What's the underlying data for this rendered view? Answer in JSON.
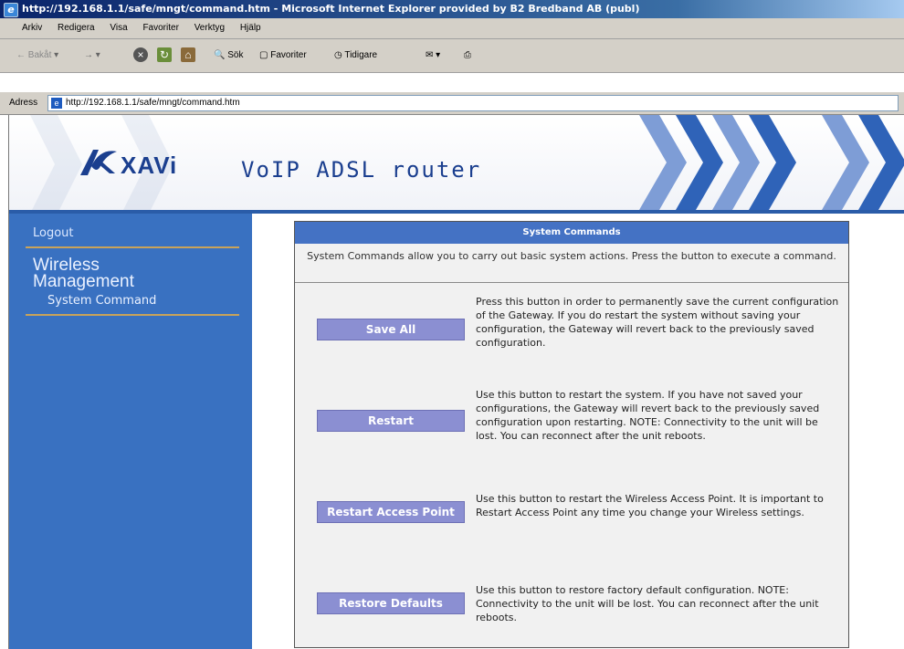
{
  "window": {
    "title": "http://192.168.1.1/safe/mngt/command.htm - Microsoft Internet Explorer provided by B2 Bredband AB (publ)"
  },
  "menu": [
    "Arkiv",
    "Redigera",
    "Visa",
    "Favoriter",
    "Verktyg",
    "Hjälp"
  ],
  "toolbar": {
    "back": "Bakåt",
    "search": "Sök",
    "favorites": "Favoriter",
    "history": "Tidigare"
  },
  "address": {
    "label": "Adress",
    "url": "http://192.168.1.1/safe/mngt/command.htm"
  },
  "banner": {
    "brand": "XAVi",
    "product": "VoIP ADSL router"
  },
  "sidebar": {
    "logout": "Logout",
    "section": "Wireless Management",
    "item": "System Command"
  },
  "panel": {
    "title": "System Commands",
    "intro": "System Commands allow you to carry out basic system actions. Press the button to execute a command.",
    "commands": [
      {
        "button": "Save All",
        "description": "Press this button in order to permanently save the current configuration of the Gateway. If you do restart the system without saving your configuration, the Gateway will revert back to the previously saved configuration."
      },
      {
        "button": "Restart",
        "description": "Use this button to restart the system. If you have not saved your configurations, the Gateway will revert back to the previously saved configuration upon restarting. NOTE: Connectivity to the unit will be lost. You can reconnect after the unit reboots."
      },
      {
        "button": "Restart Access Point",
        "description": "Use this button to restart the Wireless Access Point. It is important to Restart Access Point any time you change your Wireless settings."
      },
      {
        "button": "Restore Defaults",
        "description": "Use this button to restore factory default configuration. NOTE: Connectivity to the unit will be lost. You can reconnect after the unit reboots."
      }
    ]
  },
  "colors": {
    "sidebar": "#3971c1",
    "panel_header": "#4472c4",
    "button": "#8b8fd2",
    "brand": "#1b3f8f"
  }
}
